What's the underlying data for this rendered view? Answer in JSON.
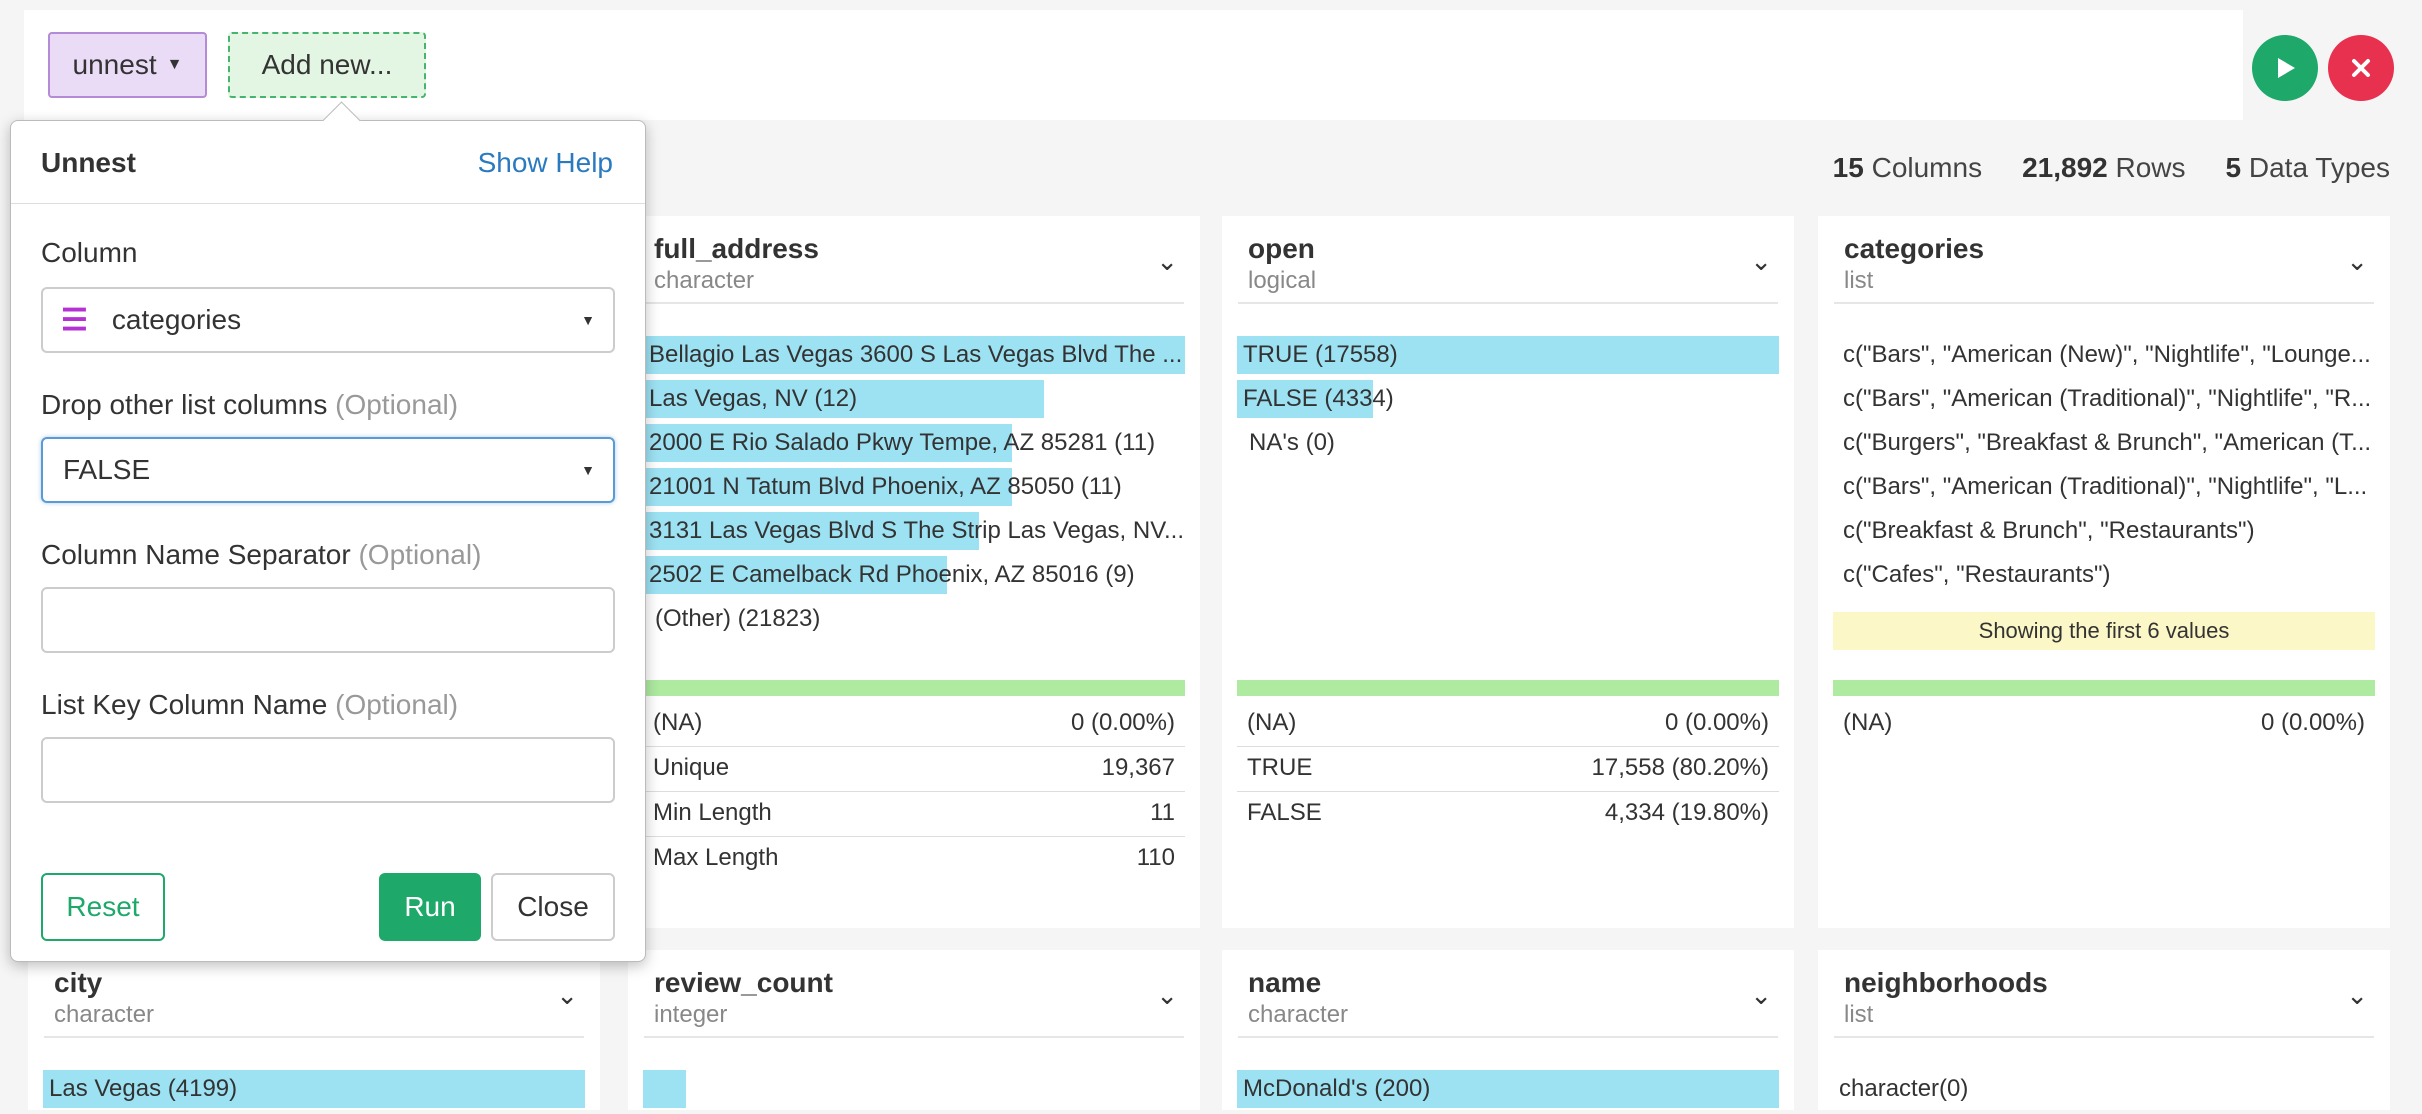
{
  "toolbar": {
    "command_label": "unnest",
    "add_label": "Add new...",
    "run_icon": "play-icon",
    "close_icon": "close-icon",
    "colors": {
      "command_bg": "#eadcf7",
      "add_bg": "#e3f5e3",
      "run": "#1ea86a",
      "cancel": "#e8304f"
    }
  },
  "stats": {
    "columns_count": "15",
    "columns_label": "Columns",
    "rows_count": "21,892",
    "rows_label": "Rows",
    "types_count": "5",
    "types_label": "Data Types"
  },
  "columns": [
    {
      "name": "full_address",
      "type": "character",
      "bars": [
        {
          "label": "Bellagio Las Vegas 3600 S Las Vegas Blvd The ...",
          "fraction": 1.0
        },
        {
          "label": "Las Vegas, NV (12)",
          "fraction": 0.74
        },
        {
          "label": "2000 E Rio Salado Pkwy Tempe, AZ 85281 (11)",
          "fraction": 0.68
        },
        {
          "label": "21001 N Tatum Blvd Phoenix, AZ 85050 (11)",
          "fraction": 0.68
        },
        {
          "label": "3131 Las Vegas Blvd S The Strip Las Vegas, NV...",
          "fraction": 0.62
        },
        {
          "label": "2502 E Camelback Rd Phoenix, AZ 85016 (9)",
          "fraction": 0.56
        }
      ],
      "other": "(Other) (21823)",
      "summary": [
        {
          "key": "(NA)",
          "value": "0 (0.00%)"
        },
        {
          "key": "Unique",
          "value": "19,367"
        },
        {
          "key": "Min Length",
          "value": "11"
        },
        {
          "key": "Max Length",
          "value": "110"
        }
      ]
    },
    {
      "name": "open",
      "type": "logical",
      "bars": [
        {
          "label": "TRUE (17558)",
          "fraction": 1.0
        },
        {
          "label": "FALSE (4334)",
          "fraction": 0.25
        }
      ],
      "other": "NA's (0)",
      "summary": [
        {
          "key": "(NA)",
          "value": "0 (0.00%)"
        },
        {
          "key": "TRUE",
          "value": "17,558 (80.20%)"
        },
        {
          "key": "FALSE",
          "value": "4,334 (19.80%)"
        }
      ]
    },
    {
      "name": "categories",
      "type": "list",
      "values": [
        "c(\"Bars\", \"American (New)\", \"Nightlife\", \"Lounge...",
        "c(\"Bars\", \"American (Traditional)\", \"Nightlife\", \"R...",
        "c(\"Burgers\", \"Breakfast & Brunch\", \"American (T...",
        "c(\"Bars\", \"American (Traditional)\", \"Nightlife\", \"L...",
        "c(\"Breakfast & Brunch\", \"Restaurants\")",
        "c(\"Cafes\", \"Restaurants\")"
      ],
      "notice": "Showing the first 6 values",
      "summary": [
        {
          "key": "(NA)",
          "value": "0 (0.00%)"
        }
      ]
    }
  ],
  "bottom_columns": [
    {
      "name": "city",
      "type": "character",
      "first_bar": "Las Vegas (4199)",
      "fraction": 1.0
    },
    {
      "name": "review_count",
      "type": "integer",
      "first_bar": "",
      "fraction": 0.08
    },
    {
      "name": "name",
      "type": "character",
      "first_bar": "McDonald's (200)",
      "fraction": 1.0
    },
    {
      "name": "neighborhoods",
      "type": "list",
      "first_bar": "character(0)",
      "fraction": 0
    }
  ],
  "popup": {
    "title": "Unnest",
    "help_link": "Show Help",
    "column_label": "Column",
    "column_value": "categories",
    "column_icon": "list-icon",
    "drop_label": "Drop other list columns",
    "drop_optional": "(Optional)",
    "drop_value": "FALSE",
    "sep_label": "Column Name Separator",
    "sep_optional": "(Optional)",
    "sep_value": "",
    "key_label": "List Key Column Name",
    "key_optional": "(Optional)",
    "key_value": "",
    "reset_label": "Reset",
    "run_label": "Run",
    "close_label": "Close"
  }
}
